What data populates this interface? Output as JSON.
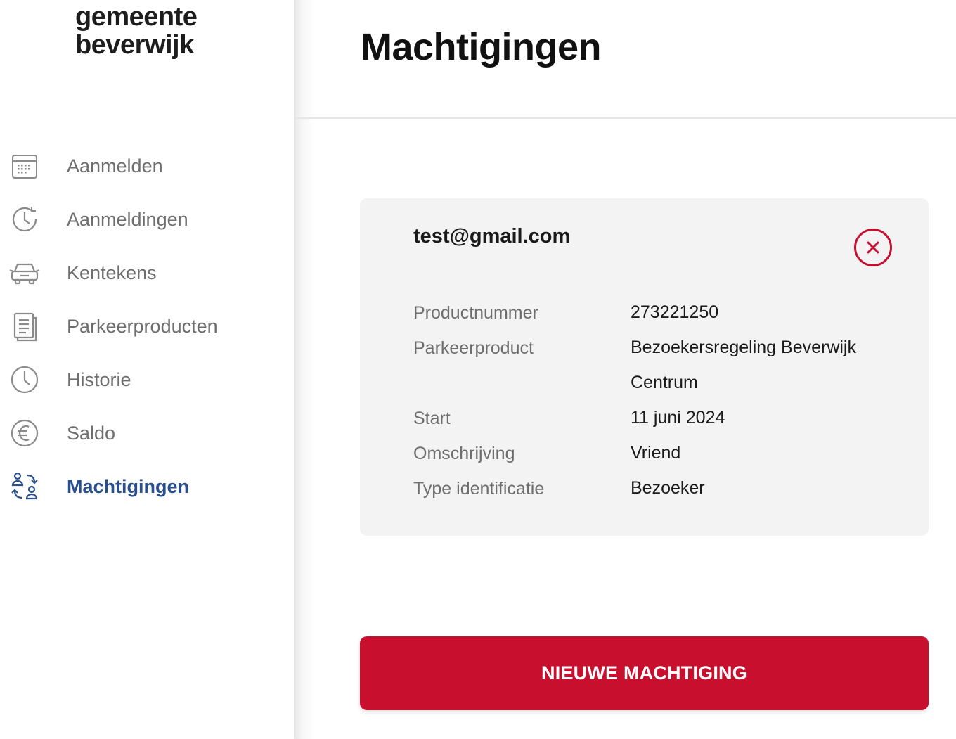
{
  "logo": {
    "line1": "gemeente",
    "line2": "beverwijk"
  },
  "sidebar": {
    "items": [
      {
        "label": "Aanmelden",
        "icon": "calendar-icon",
        "active": false
      },
      {
        "label": "Aanmeldingen",
        "icon": "clock-arrow-icon",
        "active": false
      },
      {
        "label": "Kentekens",
        "icon": "car-icon",
        "active": false
      },
      {
        "label": "Parkeerproducten",
        "icon": "document-icon",
        "active": false
      },
      {
        "label": "Historie",
        "icon": "clock-icon",
        "active": false
      },
      {
        "label": "Saldo",
        "icon": "euro-icon",
        "active": false
      },
      {
        "label": "Machtigingen",
        "icon": "users-swap-icon",
        "active": true
      }
    ]
  },
  "main": {
    "title": "Machtigingen",
    "card": {
      "email": "test@gmail.com",
      "rows": [
        {
          "label": "Productnummer",
          "value": "273221250"
        },
        {
          "label": "Parkeerproduct",
          "value": "Bezoekersregeling Beverwijk Centrum"
        },
        {
          "label": "Start",
          "value": "11 juni 2024"
        },
        {
          "label": "Omschrijving",
          "value": "Vriend"
        },
        {
          "label": "Type identificatie",
          "value": "Bezoeker"
        }
      ]
    },
    "new_button_label": "NIEUWE MACHTIGING"
  },
  "colors": {
    "accent_red": "#c8102e",
    "active_blue": "#2a4f8f",
    "muted_text": "#6e6e6e",
    "card_bg": "#f3f3f4"
  }
}
